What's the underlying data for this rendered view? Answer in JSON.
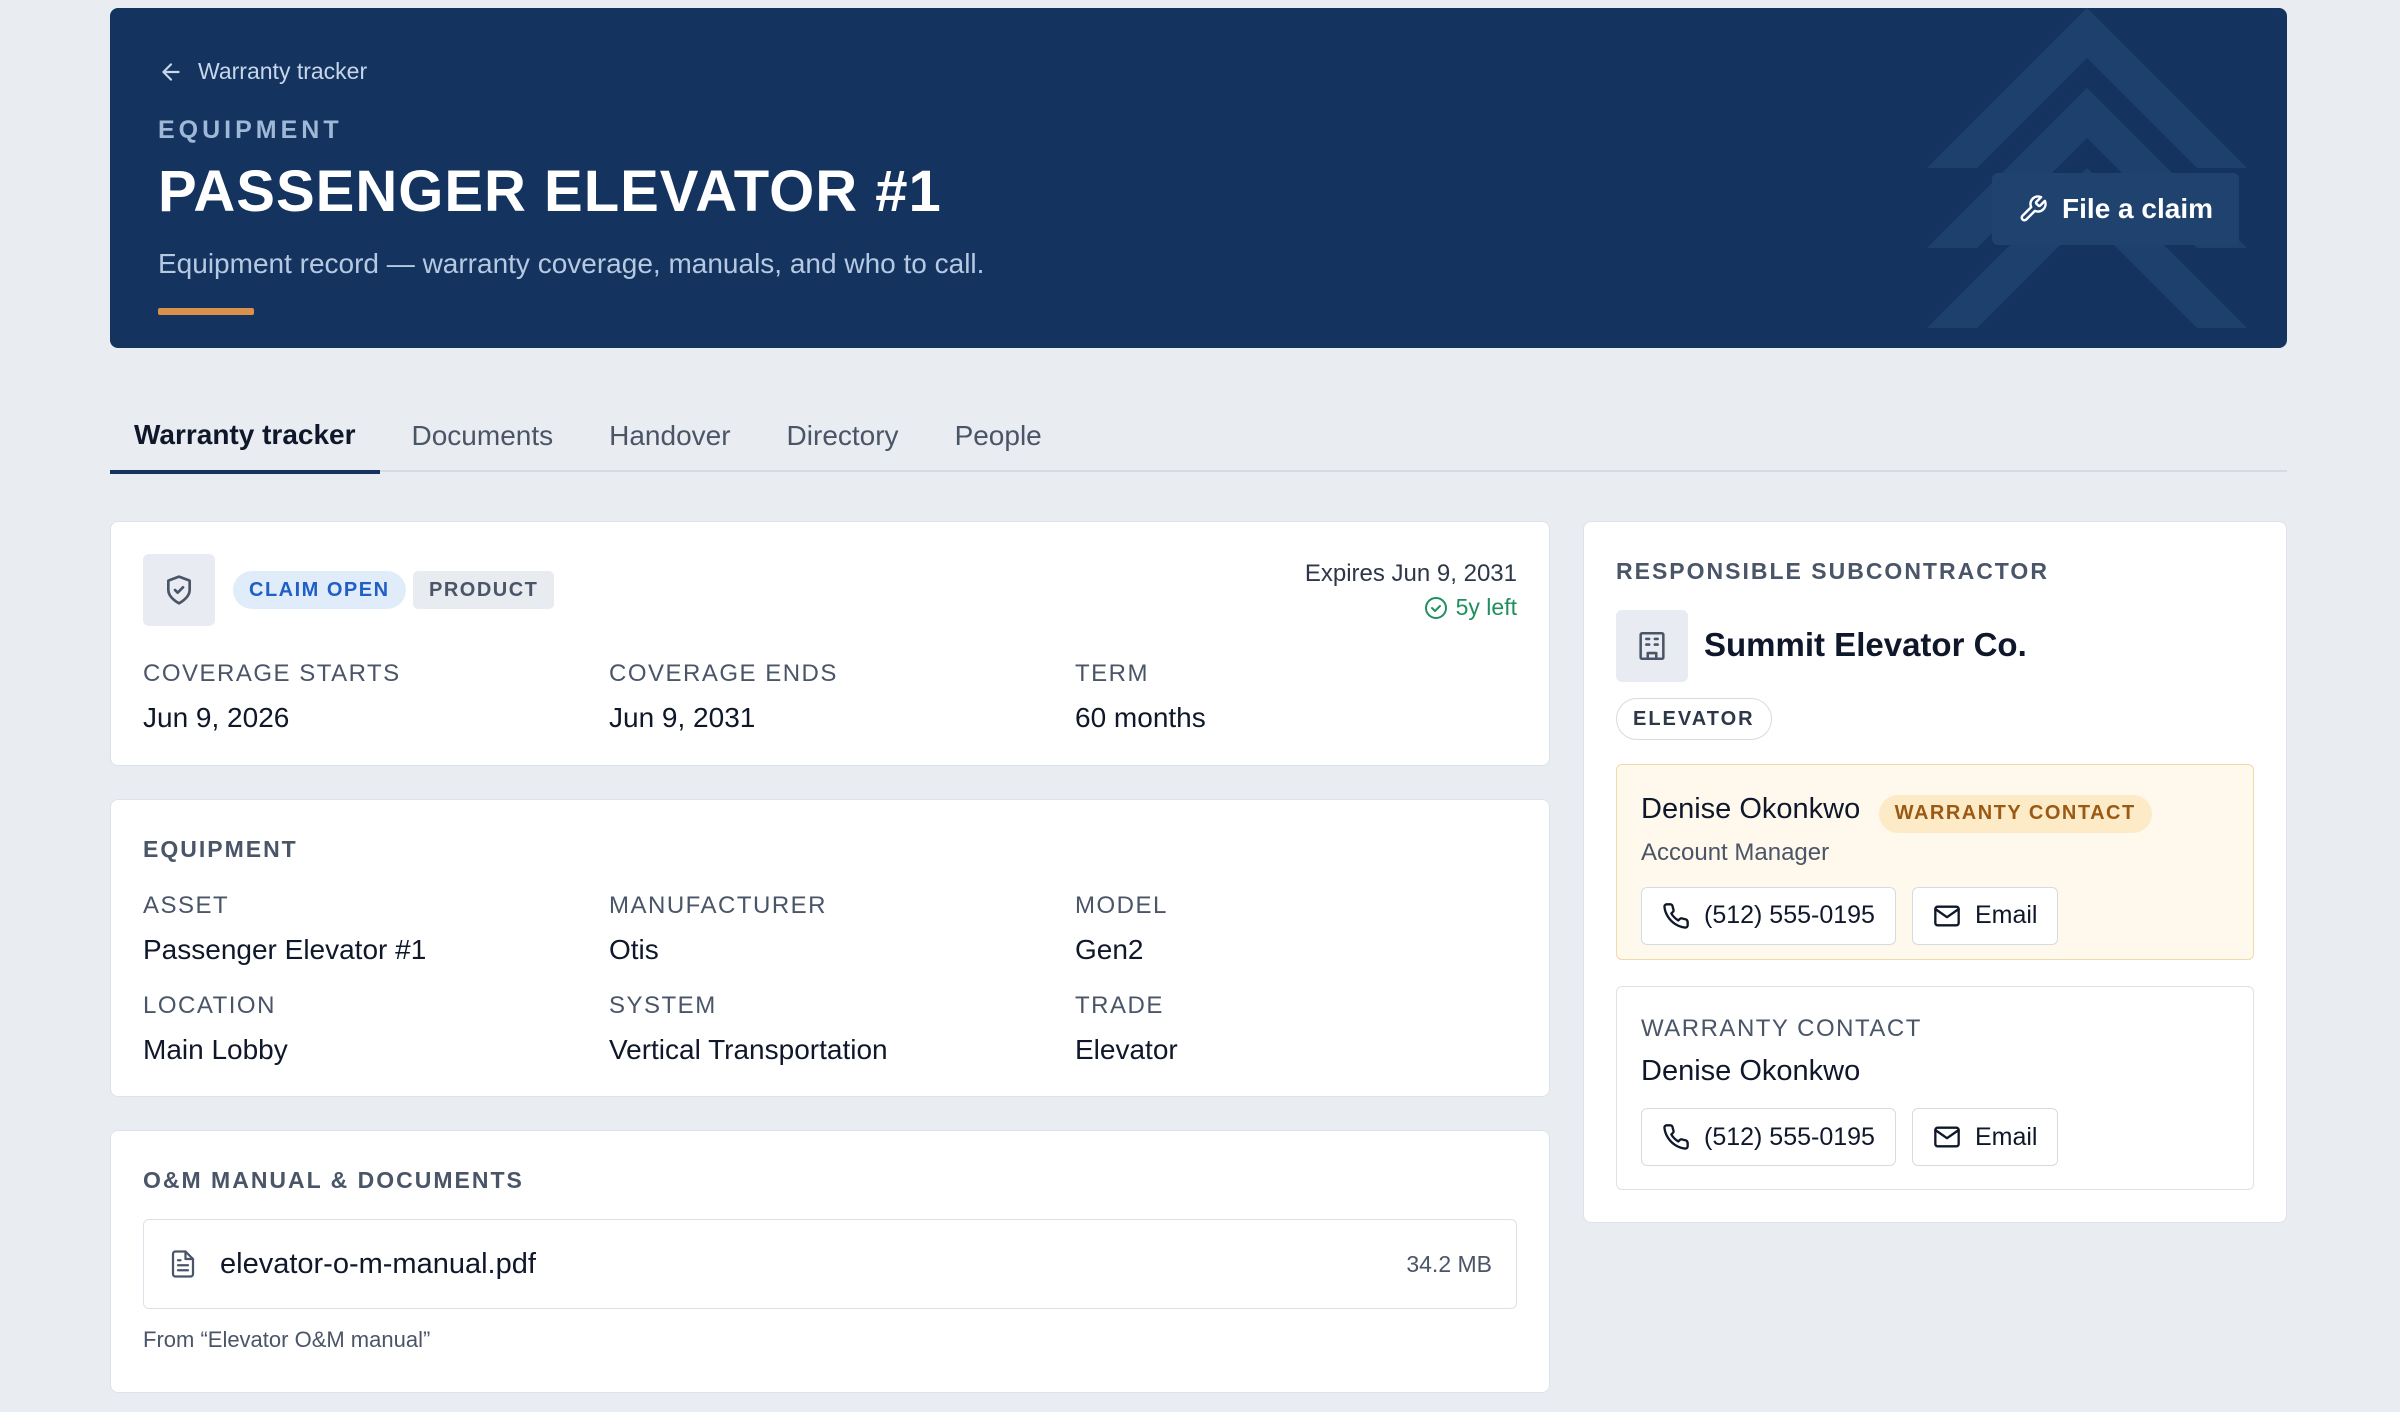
{
  "hero": {
    "back_label": "Warranty tracker",
    "eyebrow": "EQUIPMENT",
    "title": "PASSENGER ELEVATOR #1",
    "subtitle": "Equipment record — warranty coverage, manuals, and who to call.",
    "claim_button": "File a claim",
    "accent_color": "#d9914c",
    "background_color": "#14345f"
  },
  "tabs": [
    {
      "label": "Warranty tracker",
      "active": true
    },
    {
      "label": "Documents",
      "active": false
    },
    {
      "label": "Handover",
      "active": false
    },
    {
      "label": "Directory",
      "active": false
    },
    {
      "label": "People",
      "active": false
    }
  ],
  "warranty": {
    "status_badge": "CLAIM OPEN",
    "type_badge": "PRODUCT",
    "expires": "Expires Jun 9, 2031",
    "time_left": "5y left",
    "coverage_starts_label": "COVERAGE STARTS",
    "coverage_starts": "Jun 9, 2026",
    "coverage_ends_label": "COVERAGE ENDS",
    "coverage_ends": "Jun 9, 2031",
    "term_label": "TERM",
    "term": "60 months"
  },
  "equipment": {
    "heading": "EQUIPMENT",
    "asset_label": "ASSET",
    "asset": "Passenger Elevator #1",
    "manufacturer_label": "MANUFACTURER",
    "manufacturer": "Otis",
    "model_label": "MODEL",
    "model": "Gen2",
    "location_label": "LOCATION",
    "location": "Main Lobby",
    "system_label": "SYSTEM",
    "system": "Vertical Transportation",
    "trade_label": "TRADE",
    "trade": "Elevator"
  },
  "documents": {
    "heading": "O&M MANUAL & DOCUMENTS",
    "file_name": "elevator-o-m-manual.pdf",
    "file_size": "34.2 MB",
    "source": "From “Elevator O&M manual”"
  },
  "subcontractor": {
    "heading": "RESPONSIBLE SUBCONTRACTOR",
    "name": "Summit Elevator Co.",
    "trade": "ELEVATOR",
    "primary_contact": {
      "name": "Denise Okonkwo",
      "badge": "WARRANTY CONTACT",
      "role": "Account Manager",
      "phone": "(512) 555-0195",
      "email_label": "Email"
    },
    "warranty_contact": {
      "heading": "WARRANTY CONTACT",
      "name": "Denise Okonkwo",
      "phone": "(512) 555-0195",
      "email_label": "Email"
    }
  }
}
